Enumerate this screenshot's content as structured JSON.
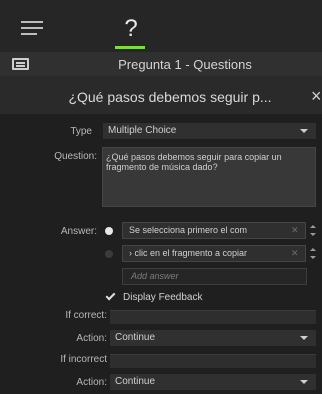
{
  "tabs": {
    "menu_icon": "hamburger-icon",
    "active_tab_icon": "question-mark-icon",
    "active_tab_glyph": "?",
    "accent_color": "#7fdc3a"
  },
  "panel": {
    "icon": "quiz-panel-icon",
    "title": "Pregunta 1 - Questions"
  },
  "question_header": {
    "title": "¿Qué pasos debemos seguir p...",
    "close_glyph": "×"
  },
  "form": {
    "type_label": "Type",
    "type_value": "Multiple Choice",
    "question_label": "Question:",
    "question_text": "¿Qué pasos debemos seguir para copiar un fragmento de música dado?",
    "answer_label": "Answer:",
    "answers": [
      {
        "text": "Se selecciona primero el com",
        "selected": true
      },
      {
        "text": "› clic en el fragmento a copiar",
        "selected": false
      }
    ],
    "delete_glyph": "✕",
    "add_answer_placeholder": "Add answer",
    "display_feedback_label": "Display Feedback",
    "display_feedback_checked": true,
    "if_correct_label": "If correct:",
    "correct_action_label": "Action:",
    "correct_action_value": "Continue",
    "if_incorrect_label": "If incorrect",
    "incorrect_action_label": "Action:",
    "incorrect_action_value": "Continue"
  }
}
